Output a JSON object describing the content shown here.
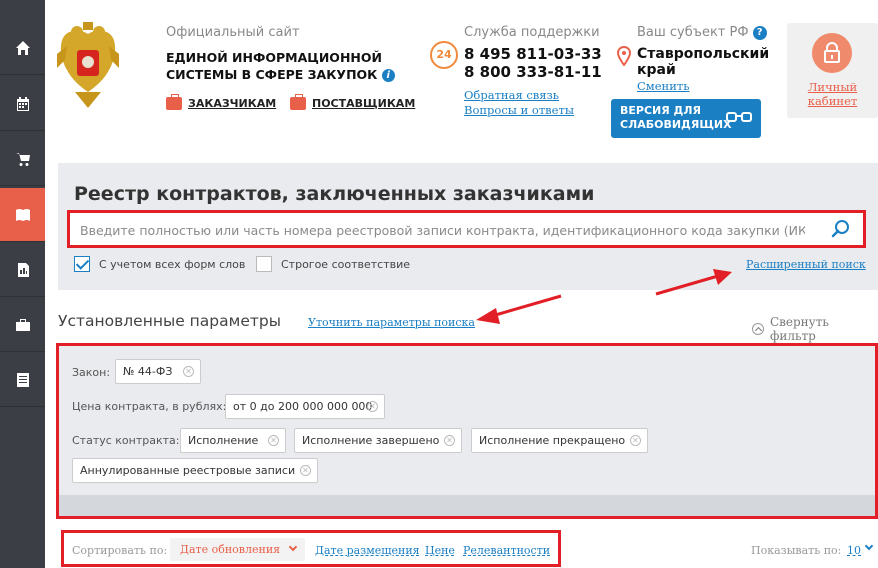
{
  "sidebar": {
    "items": [
      {
        "icon": "home-icon"
      },
      {
        "icon": "calendar-icon"
      },
      {
        "icon": "cart-icon"
      },
      {
        "icon": "book-icon",
        "active": true
      },
      {
        "icon": "report-icon"
      },
      {
        "icon": "briefcase-icon"
      },
      {
        "icon": "document-icon"
      }
    ]
  },
  "header": {
    "caption": "Официальный сайт",
    "title_line1": "ЕДИНОЙ ИНФОРМАЦИОННОЙ",
    "title_line2": "СИСТЕМЫ В СФЕРЕ ЗАКУПОК",
    "info_icon": "i",
    "customers_link": "ЗАКАЗЧИКАМ",
    "suppliers_link": "ПОСТАВЩИКАМ"
  },
  "support": {
    "caption": "Служба поддержки",
    "clock_label": "24",
    "phone1": "8 495 811-03-33",
    "phone2": "8 800 333-81-11",
    "feedback_link": "Обратная связь",
    "faq_link": "Вопросы и ответы"
  },
  "region": {
    "caption": "Ваш субъект РФ",
    "help_icon": "?",
    "name_line1": "Ставропольский",
    "name_line2": "край",
    "change_link": "Сменить",
    "low_vision_line1": "ВЕРСИЯ ДЛЯ",
    "low_vision_line2": "СЛАБОВИДЯЩИХ"
  },
  "cabinet": {
    "line1": "Личный",
    "line2": "кабинет"
  },
  "search": {
    "title": "Реестр контрактов, заключенных заказчиками",
    "placeholder": "Введите полностью или часть номера реестровой записи контракта, идентификационного кода закупки (ИК",
    "option_all_forms": "С учетом всех форм слов",
    "option_all_forms_checked": true,
    "option_strict": "Строгое соответствие",
    "option_strict_checked": false,
    "advanced_link": "Расширенный поиск"
  },
  "params": {
    "title": "Установленные параметры",
    "refine_link": "Уточнить параметры поиска",
    "collapse_link": "Свернуть фильтр",
    "law_label": "Закон:",
    "law_value": "№ 44-ФЗ",
    "price_label": "Цена контракта, в рублях:",
    "price_value": "от 0 до 200 000 000 000",
    "status_label": "Статус контракта:",
    "status_values": [
      "Исполнение",
      "Исполнение завершено",
      "Исполнение прекращено",
      "Аннулированные реестровые записи"
    ]
  },
  "sort": {
    "label": "Сортировать по:",
    "active": "Дате обновления",
    "options": [
      "Дате размещения",
      "Цене",
      "Релевантности"
    ],
    "show_label": "Показывать по:",
    "show_value": "10"
  },
  "colors": {
    "accent": "#e9604a",
    "link": "#1b7fc4",
    "highlight": "#e21f26"
  }
}
